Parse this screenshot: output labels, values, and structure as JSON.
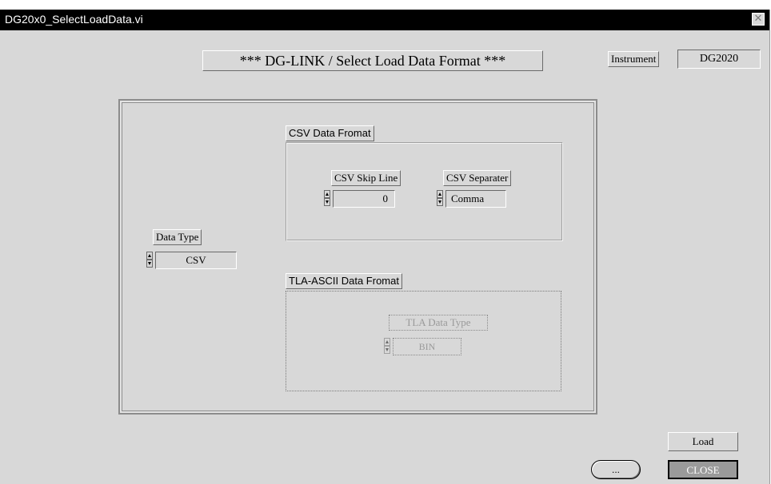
{
  "window": {
    "title": "DG20x0_SelectLoadData.vi",
    "close_glyph": "✕"
  },
  "heading": "*** DG-LINK / Select Load Data Format ***",
  "instrument": {
    "label": "Instrument",
    "value": "DG2020"
  },
  "data_type": {
    "label": "Data Type",
    "value": "CSV"
  },
  "csv_group": {
    "title": "CSV Data Fromat",
    "skip_line": {
      "label": "CSV Skip Line",
      "value": "0"
    },
    "separator": {
      "label": "CSV Separater",
      "value": "Comma"
    }
  },
  "tla_group": {
    "title": "TLA-ASCII Data Fromat",
    "data_type": {
      "label": "TLA Data Type",
      "value": "BIN"
    }
  },
  "buttons": {
    "load": "Load",
    "close": "CLOSE",
    "ellipsis": "..."
  },
  "colors": {
    "window_bg": "#d8d8d8",
    "titlebar_bg": "#000000",
    "close_bg": "#9a9a9a"
  }
}
